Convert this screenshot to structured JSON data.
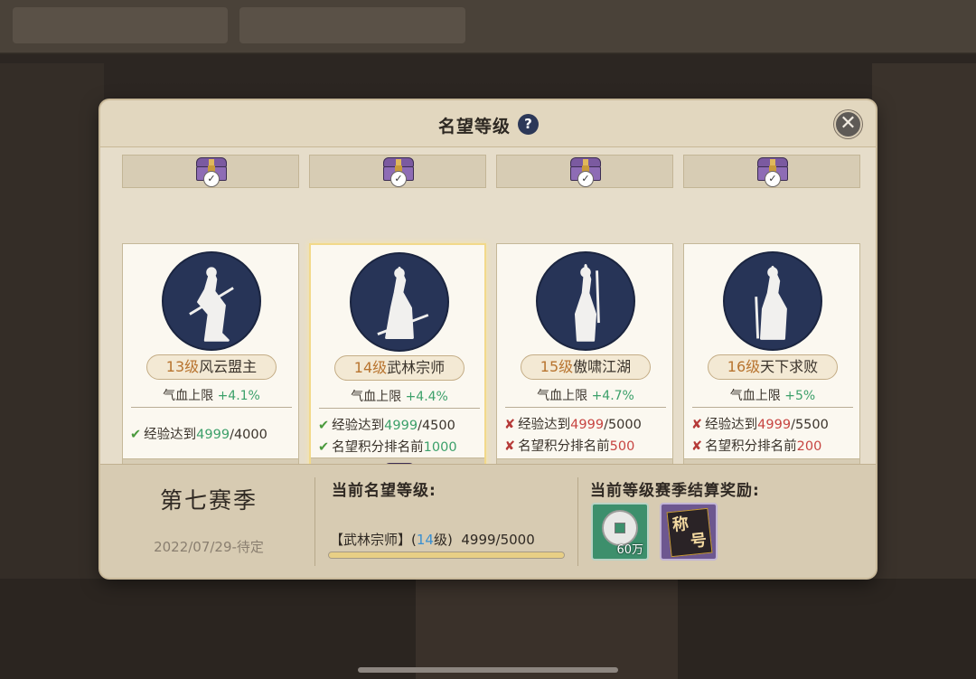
{
  "dialog": {
    "title": "名望等级",
    "help": "?",
    "close": "✕"
  },
  "cards": [
    {
      "level": "13级",
      "name": "风云盟主",
      "stat_label": "气血上限",
      "stat_value": "+4.1%",
      "top_chest_claimed": true,
      "bottom_chest_claimed": true,
      "active": false,
      "requirements": [
        {
          "met": true,
          "label": "经验达到",
          "current": "4999",
          "target": "/4000"
        }
      ]
    },
    {
      "level": "14级",
      "name": "武林宗师",
      "stat_label": "气血上限",
      "stat_value": "+4.4%",
      "top_chest_claimed": true,
      "bottom_chest_claimed": true,
      "active": true,
      "requirements": [
        {
          "met": true,
          "label": "经验达到",
          "current": "4999",
          "target": "/4500"
        },
        {
          "met": true,
          "label": "名望积分排名前",
          "current": "",
          "target": "1000"
        }
      ]
    },
    {
      "level": "15级",
      "name": "傲啸江湖",
      "stat_label": "气血上限",
      "stat_value": "+4.7%",
      "top_chest_claimed": true,
      "bottom_chest_claimed": false,
      "active": false,
      "requirements": [
        {
          "met": false,
          "label": "经验达到",
          "current": "4999",
          "target": "/5000"
        },
        {
          "met": false,
          "label": "名望积分排名前",
          "current": "",
          "target": "500"
        }
      ]
    },
    {
      "level": "16级",
      "name": "天下求败",
      "stat_label": "气血上限",
      "stat_value": "+5%",
      "top_chest_claimed": true,
      "bottom_chest_claimed": false,
      "active": false,
      "requirements": [
        {
          "met": false,
          "label": "经验达到",
          "current": "4999",
          "target": "/5500"
        },
        {
          "met": false,
          "label": "名望积分排名前",
          "current": "",
          "target": "200"
        }
      ]
    }
  ],
  "footer": {
    "season": "第七赛季",
    "date": "2022/07/29-待定",
    "current_label": "当前名望等级:",
    "current_prefix": "【武林宗师】(",
    "current_level": "14",
    "current_suffix": "级)",
    "current_exp": "4999/5000",
    "progress": 0.9998,
    "reward_label": "当前等级赛季结算奖励:",
    "rewards": [
      {
        "type": "coin",
        "qty": "60万"
      },
      {
        "type": "title",
        "glyph1": "称",
        "glyph2": "号"
      }
    ]
  },
  "colors": {
    "met": "#3ca06a",
    "unmet": "#c74542",
    "level": "#b8742f",
    "portrait_bg": "#273457"
  }
}
